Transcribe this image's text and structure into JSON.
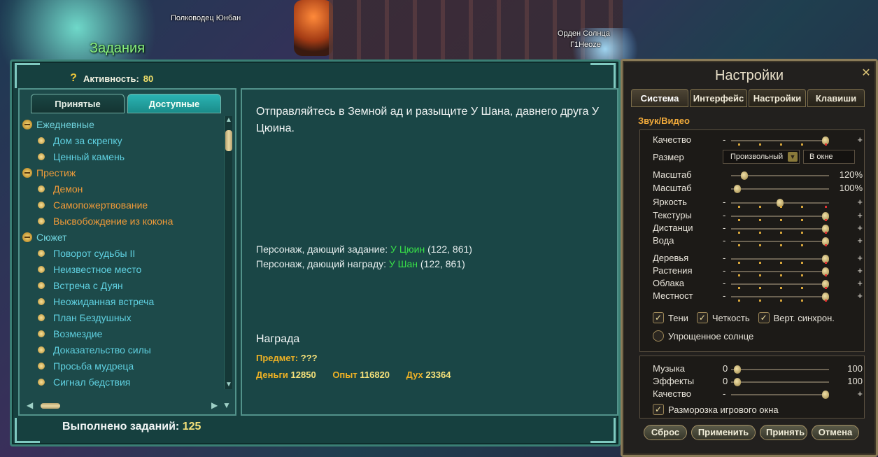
{
  "scene": {
    "npc_name_1": "Полководец Юнбан",
    "npc_name_2": "Орден Солнца",
    "npc_name_3": "Г1Неоzе"
  },
  "quest_window": {
    "title": "Задания",
    "activity_label": "Активность:",
    "activity_value": "80",
    "tabs": [
      {
        "label": "Принятые",
        "active": false
      },
      {
        "label": "Доступные",
        "active": true
      }
    ],
    "list": [
      {
        "type": "category",
        "label": "Ежедневные",
        "color": "#6fd2dc"
      },
      {
        "type": "item",
        "label": "Дом за скрепку",
        "color": "#5fd0e0"
      },
      {
        "type": "item",
        "label": "Ценный камень",
        "color": "#5fd0e0"
      },
      {
        "type": "category",
        "label": "Престиж",
        "color": "#ee9c3a"
      },
      {
        "type": "item",
        "label": "Демон",
        "color": "#f09a38"
      },
      {
        "type": "item",
        "label": "Самопожертвование",
        "color": "#f09a38"
      },
      {
        "type": "item",
        "label": "Высвобождение из кокона",
        "color": "#f09a38"
      },
      {
        "type": "category",
        "label": "Сюжет",
        "color": "#6fd2dc"
      },
      {
        "type": "item",
        "label": "Поворот судьбы II",
        "color": "#5fd0e0"
      },
      {
        "type": "item",
        "label": "Неизвестное место",
        "color": "#5fd0e0"
      },
      {
        "type": "item",
        "label": "Встреча с Дуян",
        "color": "#5fd0e0"
      },
      {
        "type": "item",
        "label": "Неожиданная встреча",
        "color": "#5fd0e0"
      },
      {
        "type": "item",
        "label": "План Бездушных",
        "color": "#5fd0e0"
      },
      {
        "type": "item",
        "label": "Возмездие",
        "color": "#5fd0e0"
      },
      {
        "type": "item",
        "label": "Доказательство силы",
        "color": "#5fd0e0"
      },
      {
        "type": "item",
        "label": "Просьба мудреца",
        "color": "#5fd0e0"
      },
      {
        "type": "item",
        "label": "Сигнал бедствия",
        "color": "#5fd0e0"
      }
    ],
    "description": "Отправляйтесь в Земной ад и разыщите У Шана, давнего друга У Цюина.",
    "giver_label": "Персонаж, дающий задание:",
    "giver_name": "У Цюин",
    "giver_coords": "(122, 861)",
    "rewarder_label": "Персонаж, дающий награду:",
    "rewarder_name": "У Шан",
    "rewarder_coords": "(122, 861)",
    "reward_title": "Награда",
    "item_label": "Предмет:",
    "item_value": "???",
    "money_label": "Деньги",
    "money_value": "12850",
    "exp_label": "Опыт",
    "exp_value": "116820",
    "spirit_label": "Дух",
    "spirit_value": "23364",
    "completed_label": "Выполнено заданий:",
    "completed_value": "125"
  },
  "settings_window": {
    "title": "Настройки",
    "tabs": [
      {
        "label": "Система",
        "active": true
      },
      {
        "label": "Интерфейс",
        "active": false
      },
      {
        "label": "Настройки",
        "active": false
      },
      {
        "label": "Клавиши",
        "active": false
      }
    ],
    "section": "Звук/Видео",
    "quality_label": "Качество",
    "size_label": "Размер",
    "size_value": "Произвольный",
    "window_mode": "В окне",
    "scale1_label": "Масштаб",
    "scale1_value": "120%",
    "scale2_label": "Масштаб",
    "scale2_value": "100%",
    "sliders": [
      {
        "label": "Яркость",
        "level": 0.5
      },
      {
        "label": "Текстуры",
        "level": 1.0
      },
      {
        "label": "Дистанци",
        "level": 1.0
      },
      {
        "label": "Вода",
        "level": 1.0
      },
      {
        "label": "Деревья",
        "level": 1.0
      },
      {
        "label": "Растения",
        "level": 1.0
      },
      {
        "label": "Облака",
        "level": 1.0
      },
      {
        "label": "Местност",
        "level": 1.0
      }
    ],
    "checks": {
      "shadows": "Тени",
      "clarity": "Четкость",
      "vsync": "Верт. синхрон.",
      "simple_sun": "Упрощенное солнце"
    },
    "music_label": "Музыка",
    "music_min": "0",
    "music_max": "100",
    "effects_label": "Эффекты",
    "effects_min": "0",
    "effects_max": "100",
    "sound_quality_label": "Качество",
    "unfreeze_label": "Разморозка игрового окна",
    "buttons": {
      "reset": "Сброс",
      "apply": "Применить",
      "accept": "Принять",
      "cancel": "Отмена"
    },
    "minus": "-",
    "plus": "+"
  }
}
